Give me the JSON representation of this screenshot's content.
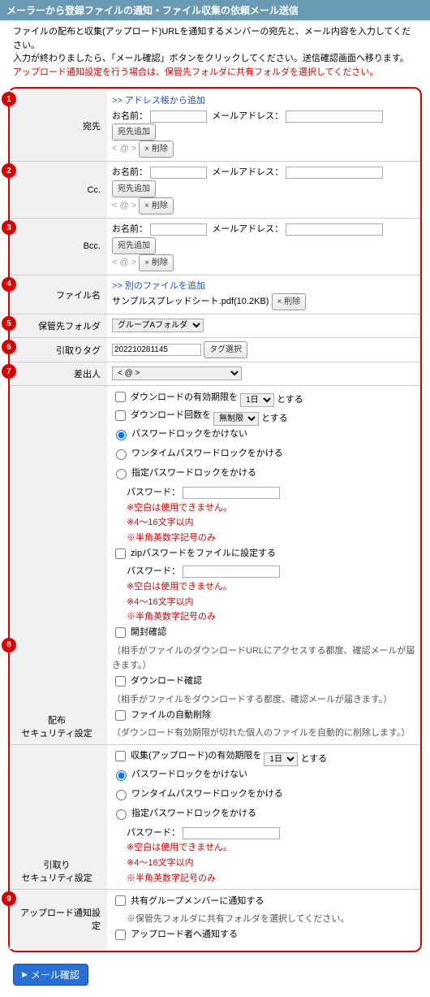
{
  "header": "メーラーから登録ファイルの通知・ファイル収集の依頼メール送信",
  "intro": {
    "l1": "ファイルの配布と収集(アップロード)URLを通知するメンバーの宛先と、メール内容を入力してください。",
    "l2": "入力が終わりましたら、「メール確認」ボタンをクリックしてください。送信確認画面へ移ります。",
    "l3": "アップロード通知設定を行う場合は、保管先フォルダに共有フォルダを選択してください。"
  },
  "addr": {
    "to_label": "宛先",
    "cc_label": "Cc.",
    "bcc_label": "Bcc.",
    "add_from_book": ">> アドレス帳から追加",
    "name_label": "お名前：",
    "email_label": "メールアドレス：",
    "add_dest_btn": "宛先追加",
    "delete_btn": "× 削除",
    "to_line": "< @ >",
    "cc_line": "< @ >",
    "bcc_line": "< @ >"
  },
  "file": {
    "label": "ファイル名",
    "add_another": ">> 別のファイルを追加",
    "name": "サンプルスプレッドシート.pdf(10.2KB)",
    "delete_btn": "× 削除"
  },
  "folder": {
    "label": "保管先フォルダ",
    "value": "グループAフォルダ"
  },
  "tag": {
    "label": "引取りタグ",
    "value": "202210281145",
    "select_btn": "タグ選択"
  },
  "sender": {
    "label": "差出人",
    "value": "< @ >"
  },
  "dist": {
    "label1": "配布",
    "label2": "セキュリティ設定",
    "dl_expiry": "ダウンロードの有効期限を",
    "dl_expiry_val": "1日",
    "to_suru": "とする",
    "dl_count": "ダウンロード回数を",
    "dl_count_val": "無制限",
    "pw_none": "パスワードロックをかけない",
    "pw_otp": "ワンタイムパスワードロックをかける",
    "pw_set": "指定パスワードロックをかける",
    "pw_label": "パスワード：",
    "w1": "※空白は使用できません。",
    "w2": "※4～16文字以内",
    "w3": "※半角英数字記号のみ",
    "zip": "zipパスワードをファイルに設定する",
    "open_conf": "開封確認",
    "open_conf_note": "（相手がファイルのダウンロードURLにアクセスする都度、確認メールが届きます。）",
    "dl_conf": "ダウンロード確認",
    "dl_conf_note": "（相手がファイルをダウンロードする都度、確認メールが届きます。）",
    "auto_del": "ファイルの自動削除",
    "auto_del_note": "（ダウンロード有効期限が切れた個人のファイルを自動的に削除します。）"
  },
  "collect": {
    "label1": "引取り",
    "label2": "セキュリティ設定",
    "up_expiry": "収集(アップロード)の有効期限を",
    "up_expiry_val": "1日",
    "to_suru": "とする",
    "pw_none": "パスワードロックをかけない",
    "pw_otp": "ワンタイムパスワードロックをかける",
    "pw_set": "指定パスワードロックをかける",
    "pw_label": "パスワード：",
    "w1": "※空白は使用できません。",
    "w2": "※4～16文字以内",
    "w3": "※半角英数字記号のみ"
  },
  "upload_notify": {
    "label": "アップロード通知設定",
    "opt1": "共有グループメンバーに通知する",
    "opt1_note": "※保管先フォルダに共有フォルダを選択してください。",
    "opt2": "アップロード者へ通知する"
  },
  "confirm_btn": "メール確認"
}
